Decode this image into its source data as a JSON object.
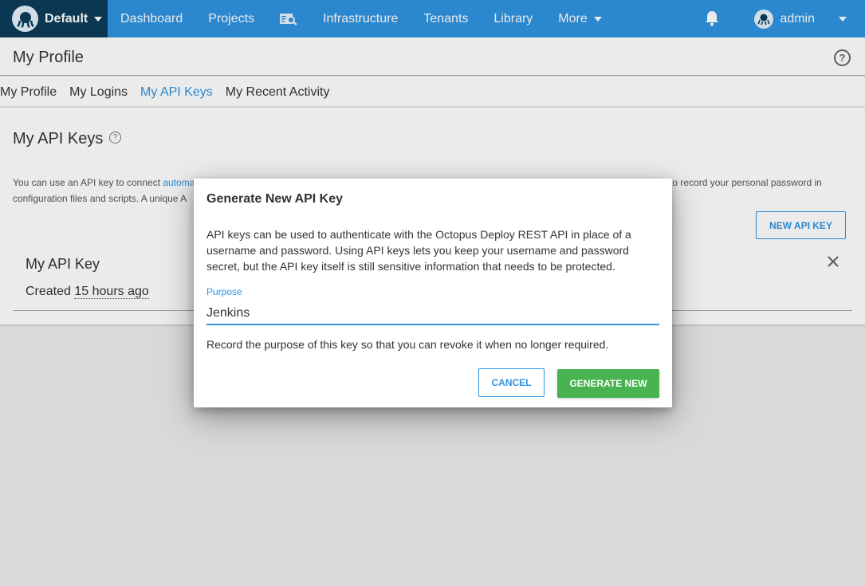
{
  "topnav": {
    "space_name": "Default",
    "items": [
      "Dashboard",
      "Projects",
      "Infrastructure",
      "Tenants",
      "Library",
      "More"
    ],
    "user": "admin"
  },
  "page": {
    "title": "My Profile",
    "tabs": [
      "My Profile",
      "My Logins",
      "My API Keys",
      "My Recent Activity"
    ],
    "active_tab": "My API Keys"
  },
  "api_keys": {
    "title": "My API Keys",
    "desc_before_link": "You can use an API key to connect ",
    "desc_link": "automa",
    "desc_middle": "ted tools to Octopus in place of your username and password. API keys are useful because they avoid the need to record your personal password in",
    "desc_line2": "configuration files and scripts. A unique A",
    "new_button": "NEW API KEY",
    "key": {
      "name": "My API Key",
      "created_label": "Created ",
      "created_ago": "15 hours ago"
    }
  },
  "dialog": {
    "title": "Generate New API Key",
    "body": "API keys can be used to authenticate with the Octopus Deploy REST API in place of a username and password. Using API keys lets you keep your username and password secret, but the API key itself is still sensitive information that needs to be protected.",
    "field_label": "Purpose",
    "field_value": "Jenkins",
    "hint": "Record the purpose of this key so that you can revoke it when no longer required.",
    "cancel_label": "CANCEL",
    "generate_label": "GENERATE NEW"
  },
  "colors": {
    "accent": "#2f93e0",
    "space_bg": "#0d3c5b",
    "success": "#48b350"
  }
}
